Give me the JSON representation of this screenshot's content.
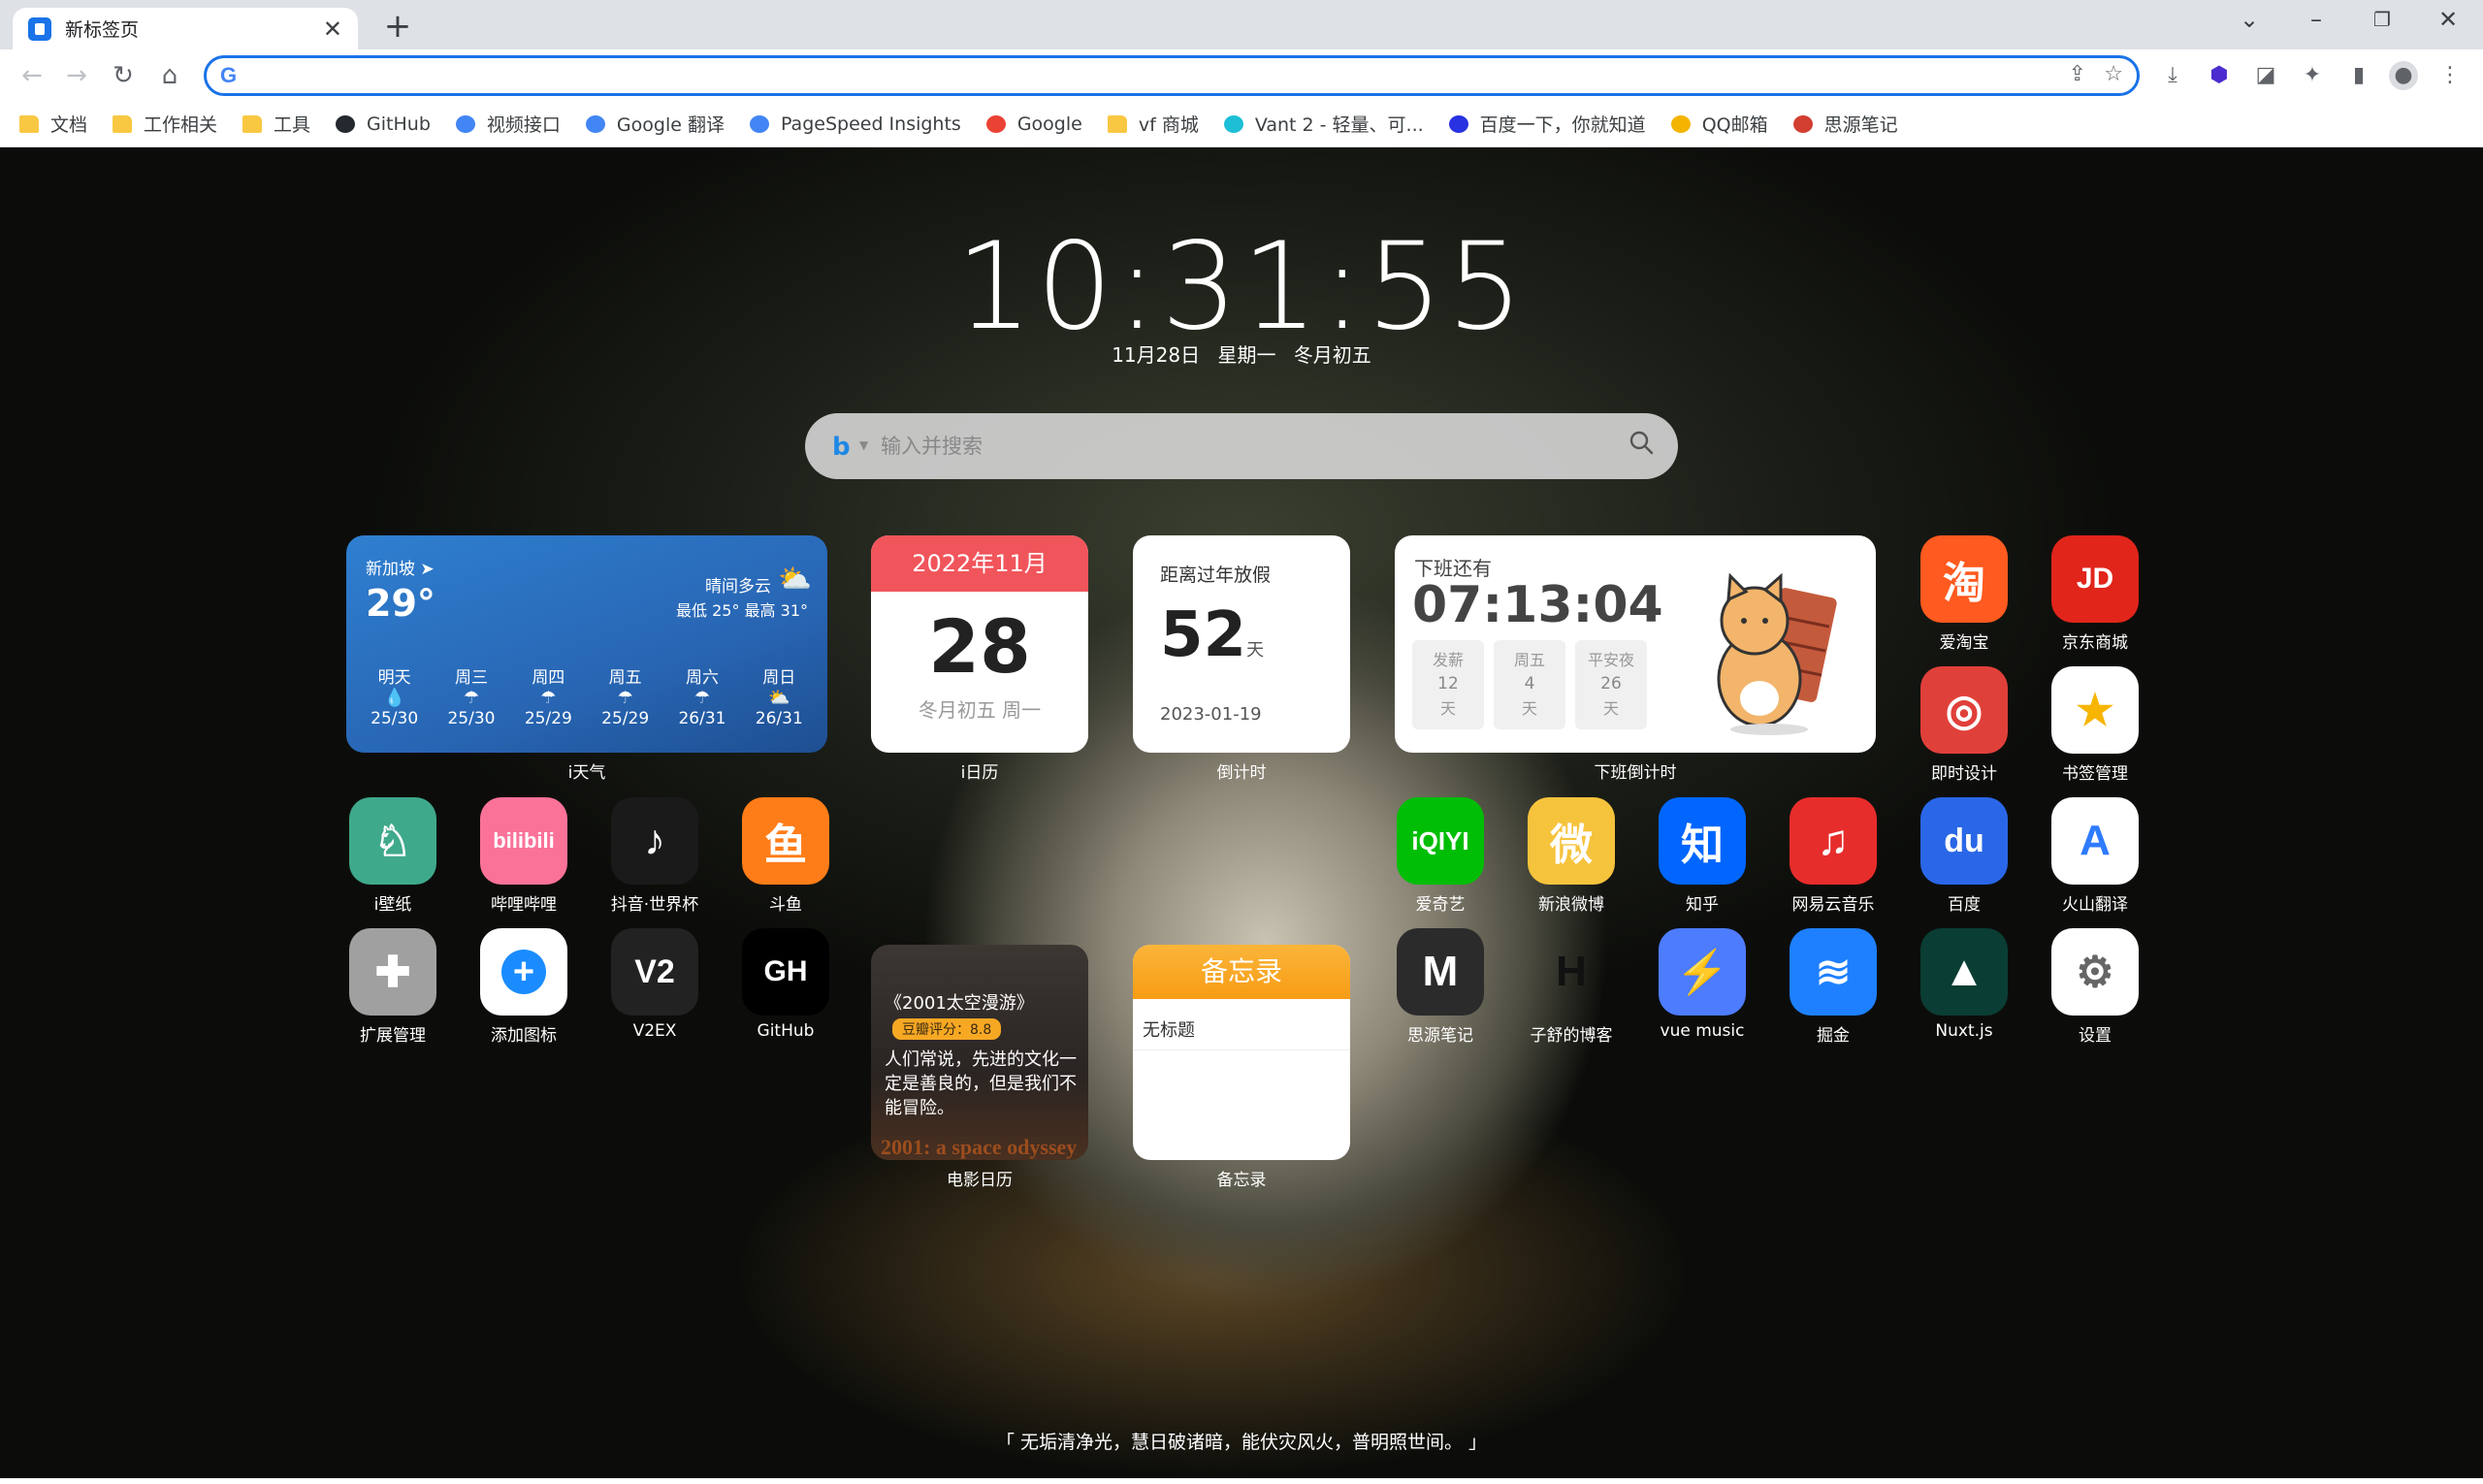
{
  "browser": {
    "tab_title": "新标签页",
    "bookmarks": [
      {
        "label": "文档",
        "icon": "folder-icon",
        "color": "#f9c843"
      },
      {
        "label": "工作相关",
        "icon": "folder-icon",
        "color": "#f9c843"
      },
      {
        "label": "工具",
        "icon": "folder-icon",
        "color": "#f9c843"
      },
      {
        "label": "GitHub",
        "icon": "github-icon",
        "color": "#24292f"
      },
      {
        "label": "视频接口",
        "icon": "doc-icon",
        "color": "#4285f4"
      },
      {
        "label": "Google 翻译",
        "icon": "google-translate-icon",
        "color": "#4285f4"
      },
      {
        "label": "PageSpeed Insights",
        "icon": "pagespeed-icon",
        "color": "#4285f4"
      },
      {
        "label": "Google",
        "icon": "google-icon",
        "color": "#ea4335"
      },
      {
        "label": "vf 商城",
        "icon": "folder-icon",
        "color": "#f9c843"
      },
      {
        "label": "Vant 2 - 轻量、可...",
        "icon": "vant-icon",
        "color": "#1dbfd6"
      },
      {
        "label": "百度一下，你就知道",
        "icon": "baidu-icon",
        "color": "#2932e1"
      },
      {
        "label": "QQ邮箱",
        "icon": "qqmail-icon",
        "color": "#f4b400"
      },
      {
        "label": "思源笔记",
        "icon": "siyuan-icon",
        "color": "#d23f31"
      }
    ]
  },
  "clock": {
    "time": "10:31:55",
    "date": "11月28日",
    "weekday": "星期一",
    "lunar": "冬月初五"
  },
  "search": {
    "placeholder": "输入并搜索"
  },
  "weather": {
    "city": "新加坡",
    "temp": "29°",
    "condition": "晴间多云",
    "range": "最低 25° 最高 31°",
    "label": "i天气",
    "days": [
      {
        "name": "明天",
        "icon": "rain-icon",
        "glyph": "💧",
        "temps": "25/30"
      },
      {
        "name": "周三",
        "icon": "cloud-rain-icon",
        "glyph": "☂",
        "temps": "25/30"
      },
      {
        "name": "周四",
        "icon": "cloud-rain-icon",
        "glyph": "☂",
        "temps": "25/29"
      },
      {
        "name": "周五",
        "icon": "cloud-rain-icon",
        "glyph": "☂",
        "temps": "25/29"
      },
      {
        "name": "周六",
        "icon": "cloud-rain-icon",
        "glyph": "☂",
        "temps": "26/31"
      },
      {
        "name": "周日",
        "icon": "partly-cloudy-icon",
        "glyph": "⛅",
        "temps": "26/31"
      }
    ]
  },
  "calendar": {
    "month": "2022年11月",
    "day": "28",
    "sub": "冬月初五 周一",
    "label": "i日历"
  },
  "countdown": {
    "title": "距离过年放假",
    "num": "52",
    "unit": "天",
    "date": "2023-01-19",
    "label": "倒计时"
  },
  "work": {
    "title": "下班还有",
    "time": "07:13:04",
    "label": "下班倒计时",
    "boxes": [
      {
        "t": "发薪",
        "n": "12",
        "u": "天"
      },
      {
        "t": "周五",
        "n": "4",
        "u": "天"
      },
      {
        "t": "平安夜",
        "n": "26",
        "u": "天"
      }
    ]
  },
  "movie": {
    "title": "《2001太空漫游》",
    "rating": "豆瓣评分：8.8",
    "quote": "人们常说，先进的文化一定是善良的，但是我们不能冒险。",
    "foot": "2001: a space odyssey",
    "label": "电影日历"
  },
  "memo": {
    "head": "备忘录",
    "item": "无标题",
    "label": "备忘录"
  },
  "apps": [
    {
      "id": "aitaobao",
      "label": "爱淘宝",
      "text": "淘",
      "bg": "#ff5a1f"
    },
    {
      "id": "jd",
      "label": "京东商城",
      "text": "JD",
      "bg": "#e1251b"
    },
    {
      "id": "jishi",
      "label": "即时设计",
      "text": "◎",
      "bg": "#e0403a"
    },
    {
      "id": "bookmarks",
      "label": "书签管理",
      "text": "★",
      "bg": "#ffffff"
    },
    {
      "id": "wallpaper",
      "label": "i壁纸",
      "text": "♘",
      "bg": "#3fa98c"
    },
    {
      "id": "bilibili",
      "label": "哔哩哔哩",
      "text": "bilibili",
      "bg": "#fb7299"
    },
    {
      "id": "douyin",
      "label": "抖音·世界杯",
      "text": "♪",
      "bg": "#1a1a1a"
    },
    {
      "id": "douyu",
      "label": "斗鱼",
      "text": "鱼",
      "bg": "#ff7d19"
    },
    {
      "id": "iqiyi",
      "label": "爱奇艺",
      "text": "iQIYI",
      "bg": "#00be06"
    },
    {
      "id": "weibo",
      "label": "新浪微博",
      "text": "微",
      "bg": "#f6c33c"
    },
    {
      "id": "zhihu",
      "label": "知乎",
      "text": "知",
      "bg": "#0066ff"
    },
    {
      "id": "music163",
      "label": "网易云音乐",
      "text": "♫",
      "bg": "#e72d2c"
    },
    {
      "id": "baidu",
      "label": "百度",
      "text": "du",
      "bg": "#2a67e8"
    },
    {
      "id": "volc",
      "label": "火山翻译",
      "text": "A",
      "bg": "#ffffff"
    },
    {
      "id": "extensions",
      "label": "扩展管理",
      "text": "✚",
      "bg": "#a0a0a0"
    },
    {
      "id": "addicon",
      "label": "添加图标",
      "text": "+",
      "bg": "#ffffff"
    },
    {
      "id": "v2ex",
      "label": "V2EX",
      "text": "V2",
      "bg": "#222222"
    },
    {
      "id": "github",
      "label": "GitHub",
      "text": "GH",
      "bg": "#000000"
    },
    {
      "id": "siyuan",
      "label": "思源笔记",
      "text": "M",
      "bg": "#2b2b2b"
    },
    {
      "id": "zishu",
      "label": "子舒的博客",
      "text": "H",
      "bg": "rgba(0,0,0,0)"
    },
    {
      "id": "vuemusic",
      "label": "vue music",
      "text": "⚡",
      "bg": "#4d7cff"
    },
    {
      "id": "juejin",
      "label": "掘金",
      "text": "≋",
      "bg": "#1e80ff"
    },
    {
      "id": "nuxt",
      "label": "Nuxt.js",
      "text": "▲",
      "bg": "#0a3d33"
    },
    {
      "id": "settings",
      "label": "设置",
      "text": "⚙",
      "bg": "#ffffff"
    }
  ],
  "quote": "「 无垢清净光，慧日破诸暗，能伏灾风火，普明照世间。 」"
}
